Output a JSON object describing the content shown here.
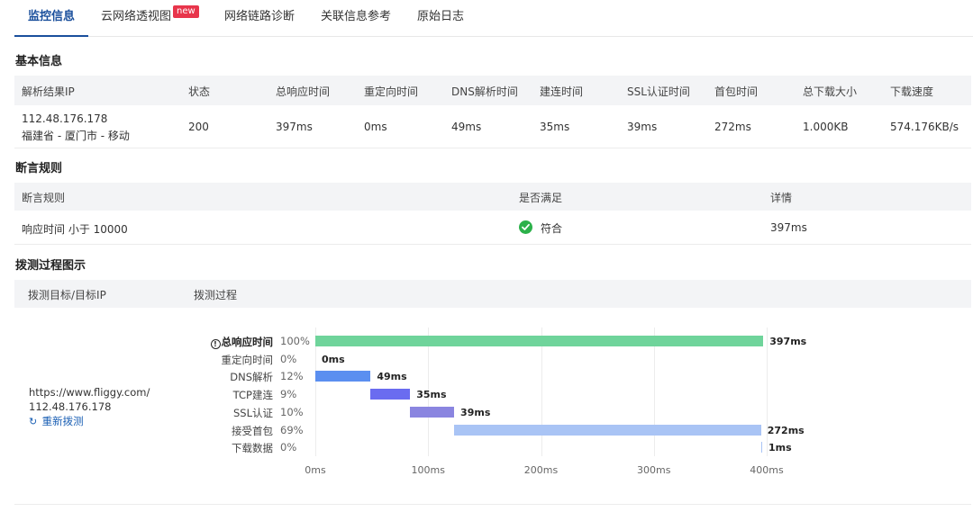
{
  "tabs": [
    {
      "label": "监控信息",
      "active": true
    },
    {
      "label": "云网络透视图",
      "badge": "new"
    },
    {
      "label": "网络链路诊断"
    },
    {
      "label": "关联信息参考"
    },
    {
      "label": "原始日志"
    }
  ],
  "basic_info": {
    "title": "基本信息",
    "headers": [
      "解析结果IP",
      "状态",
      "总响应时间",
      "重定向时间",
      "DNS解析时间",
      "建连时间",
      "SSL认证时间",
      "首包时间",
      "总下载大小",
      "下载速度"
    ],
    "row": {
      "ip": "112.48.176.178",
      "location": "福建省 - 厦门市 - 移动",
      "status": "200",
      "total_response": "397ms",
      "redirect": "0ms",
      "dns": "49ms",
      "connect": "35ms",
      "ssl": "39ms",
      "first_packet": "272ms",
      "download_size": "1.000KB",
      "download_speed": "574.176KB/s"
    }
  },
  "assertions": {
    "title": "断言规则",
    "headers": [
      "断言规则",
      "是否满足",
      "详情"
    ],
    "row": {
      "rule": "响应时间 小于 10000",
      "satisfied": "符合",
      "detail": "397ms"
    },
    "ok_color": "#2cb14a"
  },
  "process": {
    "title": "拨测过程图示",
    "headers": [
      "拨测目标/目标IP",
      "拨测过程"
    ],
    "target_url": "https://www.fliggy.com/",
    "target_ip": "112.48.176.178",
    "retest_label": "重新拨测",
    "retest_icon": "refresh-icon",
    "info_icon": "info-icon"
  },
  "chart_data": {
    "type": "bar",
    "orientation": "horizontal-gantt",
    "x_unit": "ms",
    "xlim": [
      0,
      400
    ],
    "x_ticks": [
      "0ms",
      "100ms",
      "200ms",
      "300ms",
      "400ms"
    ],
    "grid": true,
    "stages": [
      {
        "name": "总响应时间",
        "percent": "100%",
        "start": 0,
        "duration": 397,
        "label": "397ms",
        "color": "#6fd49b",
        "bold": true
      },
      {
        "name": "重定向时间",
        "percent": "0%",
        "start": 0,
        "duration": 0,
        "label": "0ms",
        "color": "#a9c4f5"
      },
      {
        "name": "DNS解析",
        "percent": "12%",
        "start": 0,
        "duration": 49,
        "label": "49ms",
        "color": "#5b8ff0"
      },
      {
        "name": "TCP建连",
        "percent": "9%",
        "start": 49,
        "duration": 35,
        "label": "35ms",
        "color": "#6a6cf0"
      },
      {
        "name": "SSL认证",
        "percent": "10%",
        "start": 84,
        "duration": 39,
        "label": "39ms",
        "color": "#8a85e0"
      },
      {
        "name": "接受首包",
        "percent": "69%",
        "start": 123,
        "duration": 272,
        "label": "272ms",
        "color": "#a9c4f5"
      },
      {
        "name": "下载数据",
        "percent": "0%",
        "start": 395,
        "duration": 1,
        "label": "1ms",
        "color": "#a9c4f5"
      }
    ]
  }
}
